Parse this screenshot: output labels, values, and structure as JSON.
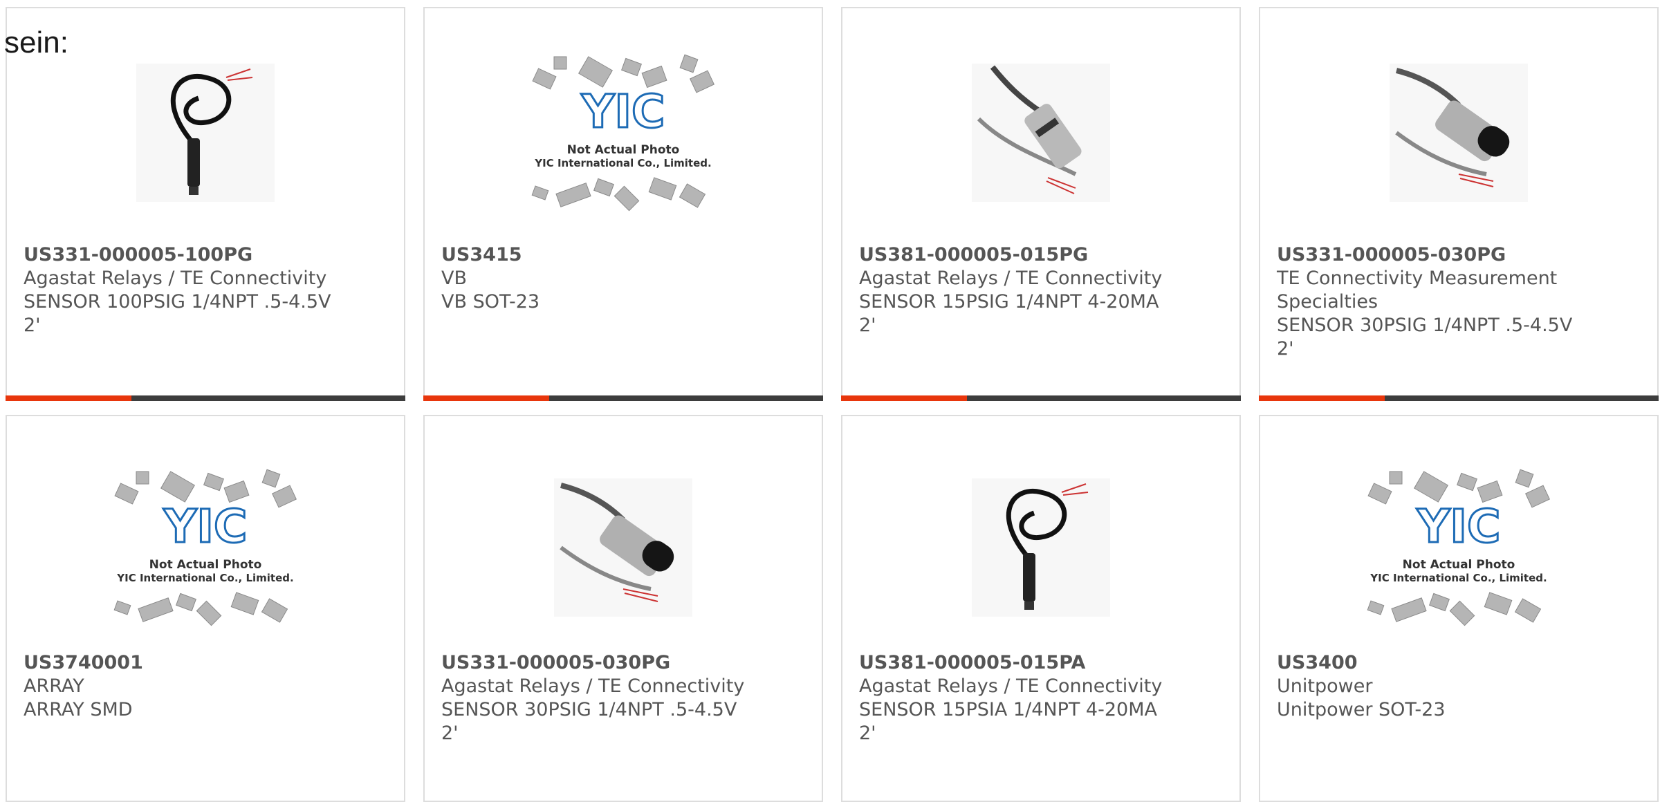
{
  "heading": "sein:",
  "colors": {
    "accent": "#e8360c",
    "bar": "#3d3d3d",
    "text": "#555555",
    "border": "#dddddd",
    "yic_blue": "#1d6bb5"
  },
  "placeholder": {
    "line1": "Not Actual Photo",
    "line2": "YIC International Co., Limited.",
    "logo_text": "YIC"
  },
  "products": [
    {
      "part": "US331-000005-100PG",
      "maker": "Agastat Relays / TE Connectivity",
      "desc": "SENSOR 100PSIG 1/4NPT .5-4.5V",
      "desc2": "2'",
      "image": "sensor-coiled-icon"
    },
    {
      "part": "US3415",
      "maker": "VB",
      "desc": "VB SOT-23",
      "desc2": "",
      "image": "not-actual-photo"
    },
    {
      "part": "US381-000005-015PG",
      "maker": "Agastat Relays / TE Connectivity",
      "desc": "SENSOR 15PSIG 1/4NPT 4-20MA",
      "desc2": "2'",
      "image": "sensor-cable-icon"
    },
    {
      "part": "US331-000005-030PG",
      "maker": "TE Connectivity Measurement Specialties",
      "desc": "SENSOR 30PSIG 1/4NPT .5-4.5V",
      "desc2": "2'",
      "image": "sensor-angled-icon"
    },
    {
      "part": "US3740001",
      "maker": "ARRAY",
      "desc": "ARRAY SMD",
      "desc2": "",
      "image": "not-actual-photo"
    },
    {
      "part": "US331-000005-030PG",
      "maker": "Agastat Relays / TE Connectivity",
      "desc": "SENSOR 30PSIG 1/4NPT .5-4.5V",
      "desc2": "2'",
      "image": "sensor-angled-icon"
    },
    {
      "part": "US381-000005-015PA",
      "maker": "Agastat Relays / TE Connectivity",
      "desc": "SENSOR 15PSIA 1/4NPT 4-20MA",
      "desc2": "2'",
      "image": "sensor-coiled-icon"
    },
    {
      "part": "US3400",
      "maker": "Unitpower",
      "desc": "Unitpower SOT-23",
      "desc2": "",
      "image": "not-actual-photo"
    }
  ]
}
